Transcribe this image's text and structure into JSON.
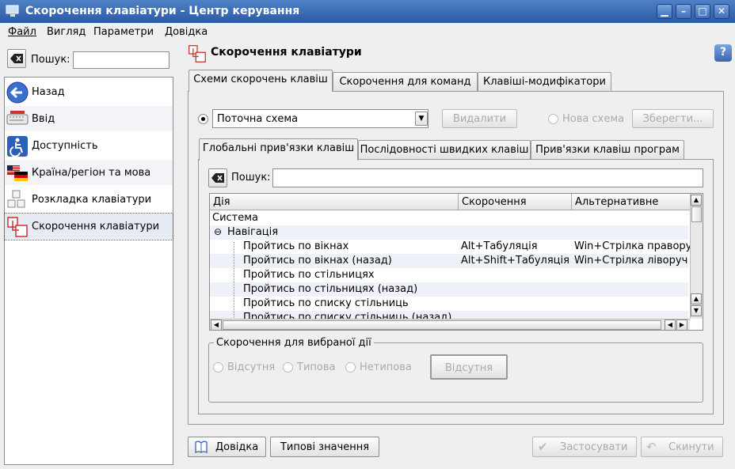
{
  "window": {
    "title": "Скорочення клавіатури - Центр керування"
  },
  "menu": {
    "file": "Файл",
    "view": "Вигляд",
    "settings": "Параметри",
    "help": "Довідка"
  },
  "sidebar": {
    "search_label": "Пошук:",
    "search_value": "",
    "items": [
      {
        "label": "Назад"
      },
      {
        "label": "Ввід"
      },
      {
        "label": "Доступність"
      },
      {
        "label": "Країна/регіон та мова"
      },
      {
        "label": "Розкладка клавіатури"
      },
      {
        "label": "Скорочення клавіатури"
      }
    ]
  },
  "module": {
    "title": "Скорочення клавіатури"
  },
  "tabs": {
    "main": [
      "Схеми скорочень клавіш",
      "Скорочення для команд",
      "Клавіші-модифікатори"
    ],
    "sub": [
      "Глобальні прив'язки клавіш",
      "Послідовності швидких клавіш",
      "Прив'язки клавіш програм"
    ]
  },
  "scheme": {
    "current": "Поточна схема",
    "delete": "Видалити",
    "new_scheme": "Нова схема",
    "save": "Зберегти..."
  },
  "filter": {
    "label": "Пошук:",
    "value": ""
  },
  "table": {
    "columns": [
      "Дія",
      "Скорочення",
      "Альтернативне"
    ],
    "rows": [
      {
        "action": "Система",
        "shortcut": "",
        "alt": ""
      },
      {
        "action": "Навігація",
        "shortcut": "",
        "alt": ""
      },
      {
        "action": "Пройтись по вікнах",
        "shortcut": "Alt+Табуляція",
        "alt": "Win+Стрілка праворуч"
      },
      {
        "action": "Пройтись по вікнах (назад)",
        "shortcut": "Alt+Shift+Табуляція",
        "alt": "Win+Стрілка ліворуч"
      },
      {
        "action": "Пройтись по стільницях",
        "shortcut": "",
        "alt": ""
      },
      {
        "action": "Пройтись по стільницях (назад)",
        "shortcut": "",
        "alt": ""
      },
      {
        "action": "Пройтись по списку стільниць",
        "shortcut": "",
        "alt": ""
      },
      {
        "action": "Пройтись по списку стільниць (назад)",
        "shortcut": "",
        "alt": ""
      }
    ],
    "collapse_symbol": "⊖"
  },
  "selected": {
    "group_title": "Скорочення для вибраної дії",
    "none": "Відсутня",
    "default": "Типова",
    "custom": "Нетипова",
    "key_button": "Відсутня"
  },
  "bottom": {
    "help": "Довідка",
    "defaults": "Типові значення",
    "apply": "Застосувати",
    "reset": "Скинути"
  },
  "colors": {
    "titlebar": "#2b5aa5",
    "selection": "#e7ecf4"
  }
}
